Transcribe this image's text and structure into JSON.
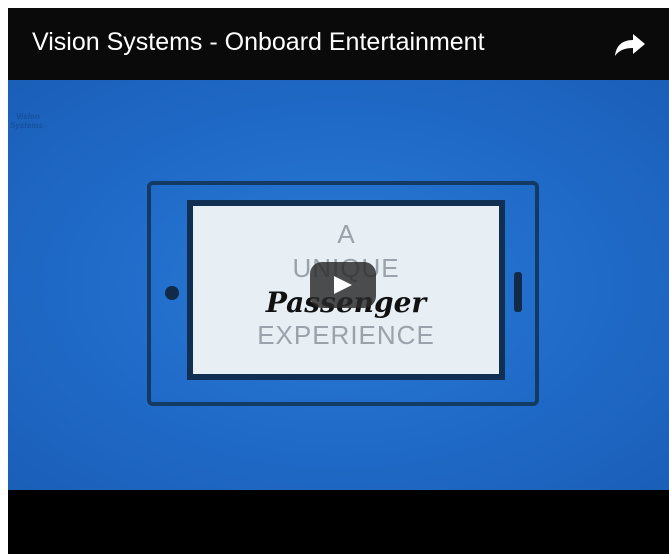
{
  "header": {
    "title": "Vision Systems - Onboard Entertainment",
    "share_icon": "share-arrow-icon"
  },
  "video": {
    "logo_text": [
      "Vision",
      "Systems"
    ],
    "screen_lines": [
      "A",
      "UNIQUE",
      "Passenger",
      "EXPERIENCE"
    ],
    "play_icon": "play-icon"
  },
  "colors": {
    "video_blue": "#2a79d6",
    "tablet_border": "#102f52",
    "screen_bg": "#e7eef4",
    "bar_bg": "#0a0a0a"
  }
}
